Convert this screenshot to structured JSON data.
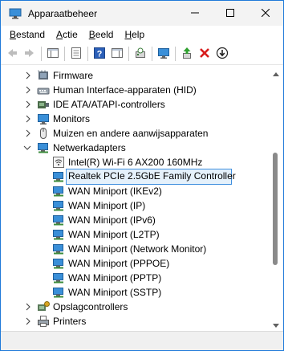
{
  "window": {
    "title": "Apparaatbeheer",
    "icons": {
      "app": "device-manager-icon",
      "minimize": "minimize-icon",
      "maximize": "maximize-icon",
      "close": "close-icon"
    }
  },
  "menu": {
    "items": [
      {
        "first": "B",
        "rest": "estand"
      },
      {
        "first": "A",
        "rest": "ctie"
      },
      {
        "first": "B",
        "rest": "eeld"
      },
      {
        "first": "H",
        "rest": "elp"
      }
    ]
  },
  "toolbar": {
    "buttons": [
      "back-arrow-icon",
      "forward-arrow-icon",
      "show-hide-console-tree-icon",
      "properties-icon",
      "help-icon",
      "show-hide-action-pane-icon",
      "scan-hardware-icon",
      "monitor-icon",
      "update-driver-icon",
      "uninstall-device-icon",
      "disable-device-icon"
    ],
    "colors": {
      "uninstall_red": "#d81e1e",
      "help_blue": "#2b5fb8"
    }
  },
  "tree": {
    "categories_top": [
      {
        "label": "Firmware",
        "icon": "firmware-icon"
      },
      {
        "label": "Human Interface-apparaten (HID)",
        "icon": "hid-icon"
      },
      {
        "label": "IDE ATA/ATAPI-controllers",
        "icon": "ide-controller-icon"
      },
      {
        "label": "Monitors",
        "icon": "monitor-icon"
      },
      {
        "label": "Muizen en andere aanwijsapparaten",
        "icon": "mouse-icon"
      },
      {
        "label": "Netwerkadapters",
        "icon": "network-adapter-icon",
        "expanded": true
      }
    ],
    "network_children": [
      {
        "label": "Intel(R) Wi-Fi 6 AX200 160MHz",
        "icon": "wifi-adapter-icon"
      },
      {
        "label": "Realtek PCIe 2.5GbE Family Controller",
        "icon": "network-adapter-icon",
        "selected": true
      },
      {
        "label": "WAN Miniport (IKEv2)",
        "icon": "network-adapter-icon"
      },
      {
        "label": "WAN Miniport (IP)",
        "icon": "network-adapter-icon"
      },
      {
        "label": "WAN Miniport (IPv6)",
        "icon": "network-adapter-icon"
      },
      {
        "label": "WAN Miniport (L2TP)",
        "icon": "network-adapter-icon"
      },
      {
        "label": "WAN Miniport (Network Monitor)",
        "icon": "network-adapter-icon"
      },
      {
        "label": "WAN Miniport (PPPOE)",
        "icon": "network-adapter-icon"
      },
      {
        "label": "WAN Miniport (PPTP)",
        "icon": "network-adapter-icon"
      },
      {
        "label": "WAN Miniport (SSTP)",
        "icon": "network-adapter-icon"
      }
    ],
    "categories_bottom": [
      {
        "label": "Opslagcontrollers",
        "icon": "storage-controller-icon"
      },
      {
        "label": "Printers",
        "icon": "printer-icon"
      }
    ],
    "colors": {
      "selected_bg": "#e5f1fb",
      "selected_border": "#3e8ede"
    }
  }
}
